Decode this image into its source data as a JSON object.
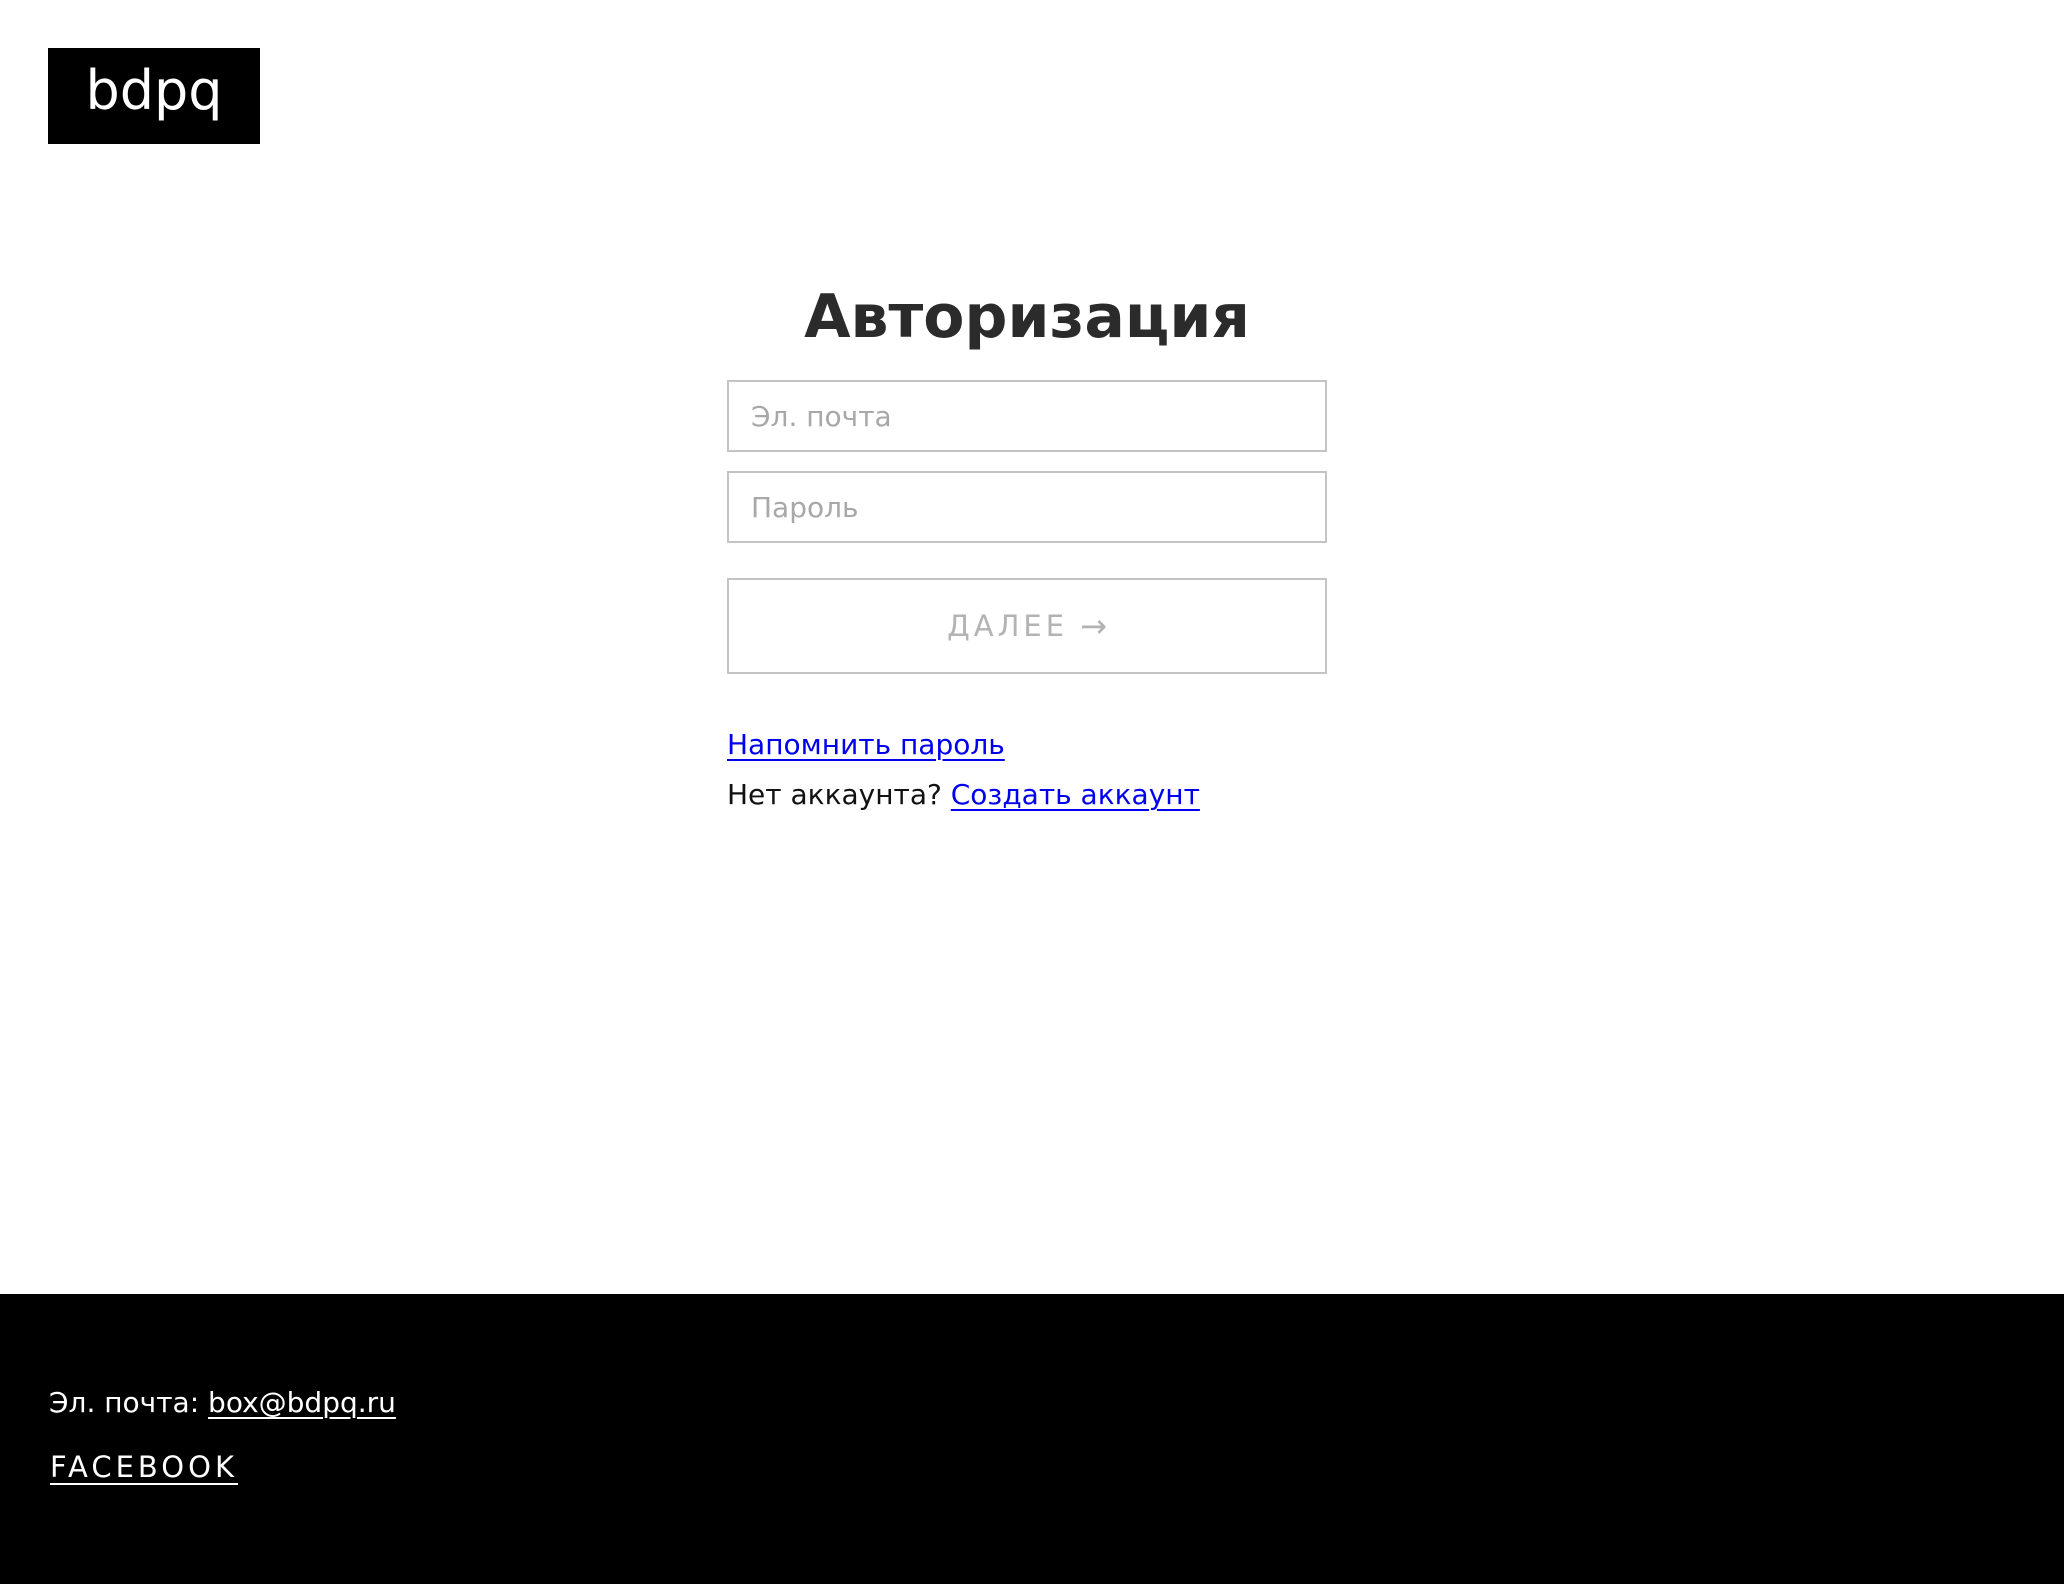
{
  "header": {
    "logo_text": "bdpq"
  },
  "auth": {
    "title": "Авторизация",
    "email_placeholder": "Эл. почта",
    "email_value": "",
    "password_placeholder": "Пароль",
    "password_value": "",
    "submit_label": "ДАЛЕЕ",
    "submit_arrow": "→",
    "remind_password_link": "Напомнить пароль",
    "no_account_text": "Нет аккаунта?",
    "create_account_link": "Создать аккаунт"
  },
  "footer": {
    "email_label": "Эл. почта:",
    "email_link": "box@bdpq.ru",
    "facebook_link": "FACEBOOK"
  },
  "colors": {
    "link": "#0000ee",
    "footer_bg": "#000000",
    "border": "#c4c4c4",
    "placeholder": "#a8a8a8",
    "title": "#2b2b2b"
  }
}
